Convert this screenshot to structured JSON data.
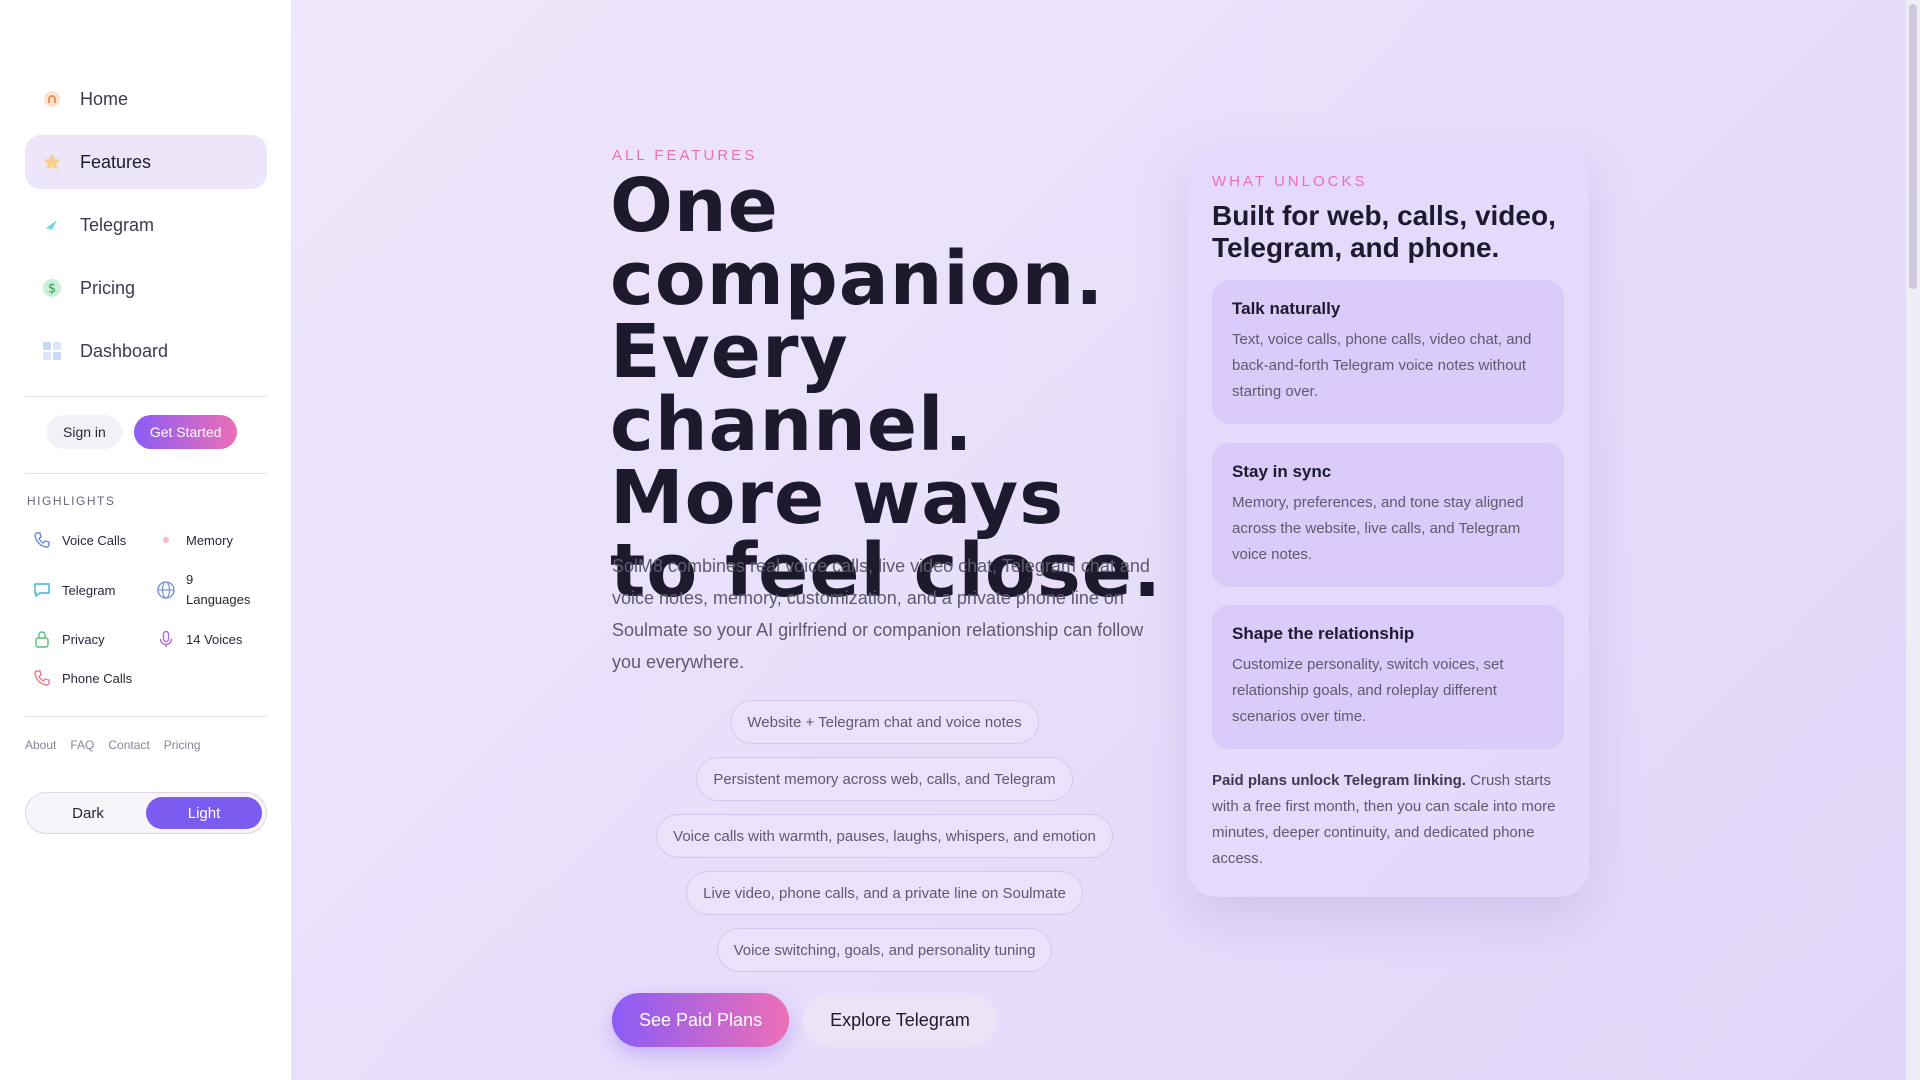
{
  "sidebar": {
    "nav": [
      {
        "label": "Home",
        "icon": "home-icon"
      },
      {
        "label": "Features",
        "icon": "star-icon",
        "active": true
      },
      {
        "label": "Telegram",
        "icon": "send-icon"
      },
      {
        "label": "Pricing",
        "icon": "dollar-icon"
      },
      {
        "label": "Dashboard",
        "icon": "grid-icon"
      }
    ],
    "sign_in": "Sign in",
    "get_started": "Get Started",
    "highlights_title": "HIGHLIGHTS",
    "highlights": [
      {
        "label": "Voice Calls",
        "icon": "phone-icon"
      },
      {
        "label": "Memory",
        "icon": "sparkle-icon"
      },
      {
        "label": "Telegram",
        "icon": "chat-icon"
      },
      {
        "label": "9 Languages",
        "icon": "globe-icon"
      },
      {
        "label": "Privacy",
        "icon": "lock-icon"
      },
      {
        "label": "14 Voices",
        "icon": "mic-icon"
      },
      {
        "label": "Phone Calls",
        "icon": "phone-ring-icon"
      }
    ],
    "footer_links": [
      "About",
      "FAQ",
      "Contact",
      "Pricing"
    ],
    "theme": {
      "dark": "Dark",
      "light": "Light",
      "selected": "Light"
    }
  },
  "main": {
    "eyebrow": "ALL FEATURES",
    "title": "One companion. Every channel. More ways to feel close.",
    "description": "SolM8 combines real voice calls, live video chat, Telegram chat and voice notes, memory, customization, and a private phone line on Soulmate so your AI girlfriend or companion relationship can follow you everywhere.",
    "pills": [
      "Website + Telegram chat and voice notes",
      "Persistent memory across web, calls, and Telegram",
      "Voice calls with warmth, pauses, laughs, whispers, and emotion",
      "Live video, phone calls, and a private line on Soulmate",
      "Voice switching, goals, and personality tuning"
    ],
    "primary_cta": "See Paid Plans",
    "secondary_cta": "Explore Telegram"
  },
  "card": {
    "eyebrow": "WHAT UNLOCKS",
    "title": "Built for web, calls, video, Telegram, and phone.",
    "features": [
      {
        "title": "Talk naturally",
        "body": "Text, voice calls, phone calls, video chat, and back-and-forth Telegram voice notes without starting over."
      },
      {
        "title": "Stay in sync",
        "body": "Memory, preferences, and tone stay aligned across the website, live calls, and Telegram voice notes."
      },
      {
        "title": "Shape the relationship",
        "body": "Customize personality, switch voices, set relationship goals, and roleplay different scenarios over time."
      }
    ],
    "footer_bold": "Paid plans unlock Telegram linking.",
    "footer_text": " Crush starts with a free first month, then you can scale into more minutes, deeper continuity, and dedicated phone access."
  },
  "colors": {
    "accent": "#7c5cf0",
    "pink": "#ec6fb6",
    "card_bg": "#e4d8fc"
  }
}
